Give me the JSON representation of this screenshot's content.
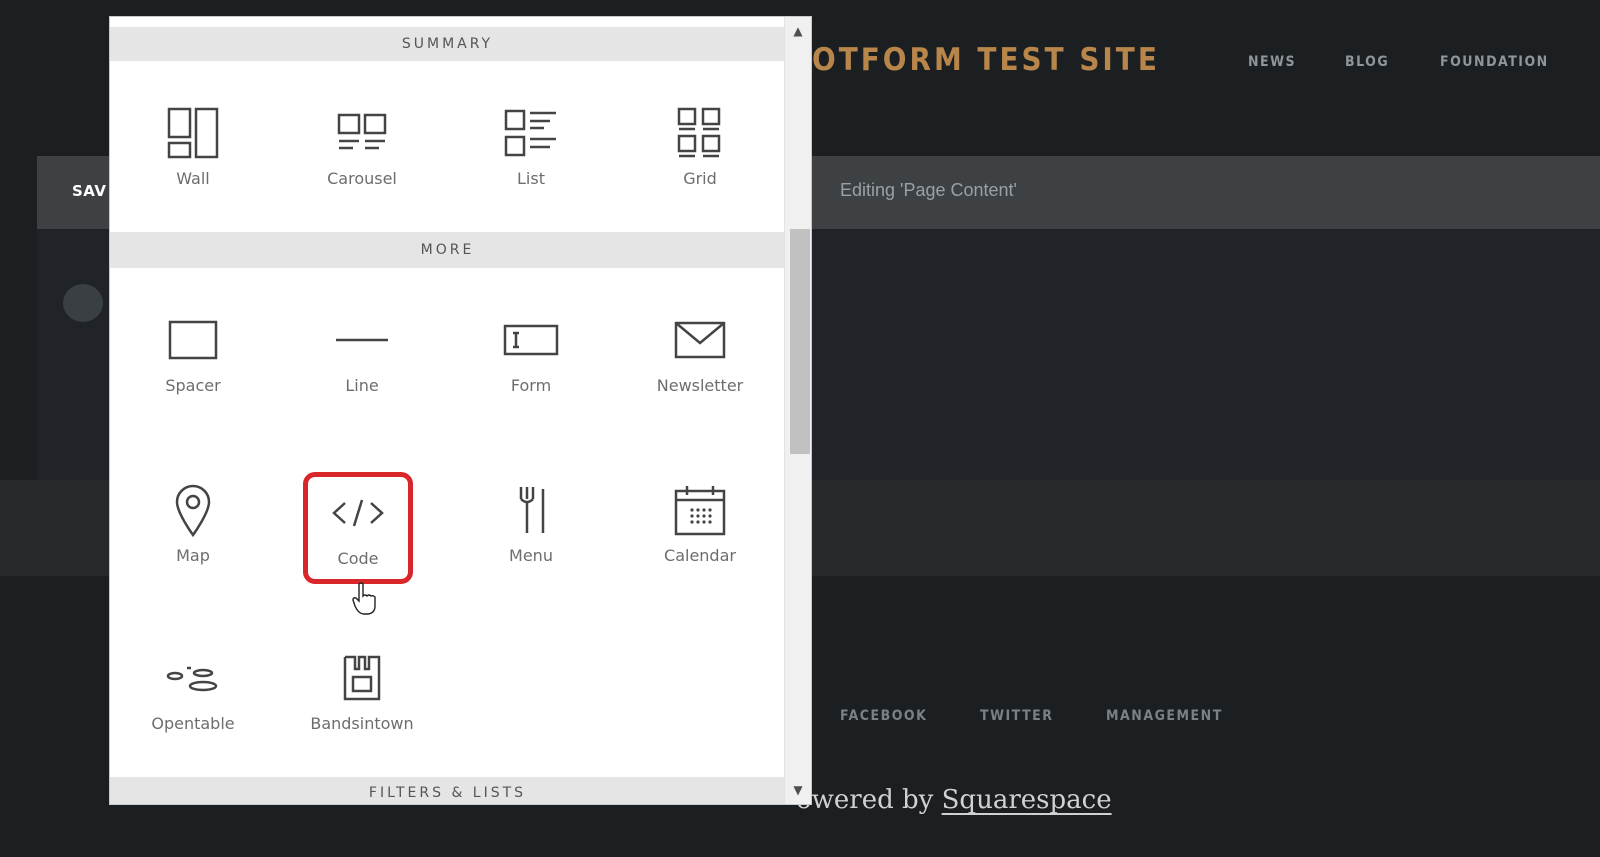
{
  "site": {
    "title": "OTFORM TEST SITE",
    "nav": [
      "NEWS",
      "BLOG",
      "FOUNDATION"
    ]
  },
  "editor": {
    "save_label": "SAV",
    "editing_label": "Editing 'Page Content'"
  },
  "footer": {
    "links": [
      "FACEBOOK",
      "TWITTER",
      "MANAGEMENT"
    ],
    "powered_prefix": "owered by",
    "powered_link": "Squarespace"
  },
  "picker": {
    "sections": {
      "summary": "SUMMARY",
      "more": "MORE",
      "filters": "FILTERS & LISTS"
    },
    "summary_items": [
      {
        "label": "Wall",
        "icon": "wall-icon"
      },
      {
        "label": "Carousel",
        "icon": "carousel-icon"
      },
      {
        "label": "List",
        "icon": "list-icon"
      },
      {
        "label": "Grid",
        "icon": "grid-icon"
      }
    ],
    "more_items": [
      {
        "label": "Spacer",
        "icon": "spacer-icon"
      },
      {
        "label": "Line",
        "icon": "line-icon"
      },
      {
        "label": "Form",
        "icon": "form-icon"
      },
      {
        "label": "Newsletter",
        "icon": "envelope-icon"
      },
      {
        "label": "Map",
        "icon": "map-pin-icon"
      },
      {
        "label": "Code",
        "icon": "code-icon",
        "highlighted": true
      },
      {
        "label": "Menu",
        "icon": "fork-knife-icon"
      },
      {
        "label": "Calendar",
        "icon": "calendar-icon"
      },
      {
        "label": "Opentable",
        "icon": "opentable-icon"
      },
      {
        "label": "Bandsintown",
        "icon": "bandsintown-icon"
      }
    ]
  },
  "colors": {
    "accent_title": "#b8864b",
    "highlight": "#d9262a",
    "background": "#1b1f22"
  }
}
